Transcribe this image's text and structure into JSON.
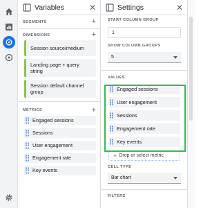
{
  "variables": {
    "title": "Variables",
    "segments_label": "SEGMENTS",
    "dimensions_label": "DIMENSIONS",
    "dimensions": [
      "Session source/medium",
      "Landing page + query string",
      "Session default channel group"
    ],
    "metrics_label": "METRICS",
    "metrics": [
      "Engaged sessions",
      "Sessions",
      "User engagement",
      "Engagement rate",
      "Key events"
    ]
  },
  "settings": {
    "title": "Settings",
    "start_column_group_label": "START COLUMN GROUP",
    "start_column_group_value": "1",
    "show_column_groups_label": "SHOW COLUMN GROUPS",
    "show_column_groups_value": "5",
    "values_label": "VALUES",
    "values": [
      "Engaged sessions",
      "User engagement",
      "Sessions",
      "Engagement rate",
      "Key events"
    ],
    "drop_label": "Drop or select metric",
    "cell_type_label": "CELL TYPE",
    "cell_type_value": "Bar chart",
    "filters_label": "FILTERS"
  },
  "colors": {
    "highlight": "#2fbf4a",
    "accent": "#1a73e8",
    "dimension_bar": "#8bc34a"
  }
}
